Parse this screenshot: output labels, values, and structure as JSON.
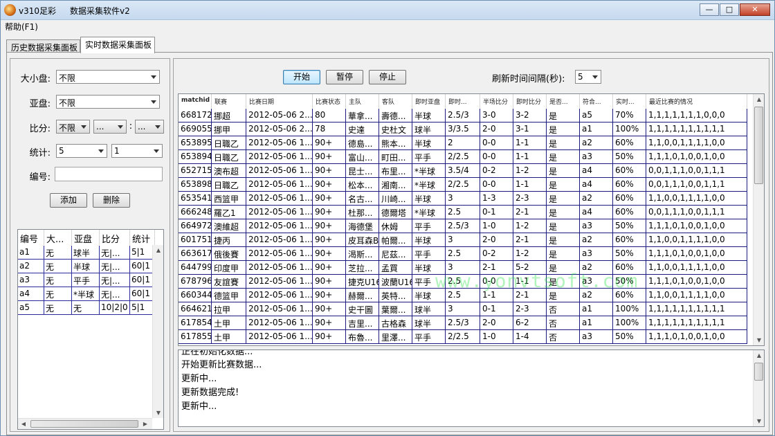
{
  "window": {
    "title": "v310足彩",
    "subtitle": "数据采集软件v2",
    "minimize_glyph": "—",
    "maximize_glyph": "□",
    "close_glyph": "✕"
  },
  "menu": {
    "help": "帮助(F1)"
  },
  "tabs": {
    "history": "历史数据采集面板",
    "realtime": "实时数据采集面板"
  },
  "filters": {
    "size_label": "大小盘:",
    "size_value": "不限",
    "asian_label": "亚盘:",
    "asian_value": "不限",
    "score_label": "比分:",
    "score_value": "不限",
    "score_home": "...",
    "score_sep": ":",
    "score_away": "...",
    "stat_label": "统计:",
    "stat_value1": "5",
    "stat_value2": "1",
    "id_label": "编号:",
    "id_value": "",
    "add_button": "添加",
    "delete_button": "删除"
  },
  "rule_table": {
    "headers": [
      "编号",
      "大...",
      "亚盘",
      "比分",
      "统计"
    ],
    "rows": [
      [
        "a1",
        "无",
        "球半",
        "无|...",
        "5|1"
      ],
      [
        "a2",
        "无",
        "半球",
        "无|...",
        "60|1"
      ],
      [
        "a3",
        "无",
        "平手",
        "无|...",
        "60|1"
      ],
      [
        "a4",
        "无",
        "*半球",
        "无|...",
        "60|1"
      ],
      [
        "a5",
        "无",
        "无",
        "10|2|0",
        "5|1"
      ]
    ]
  },
  "controls": {
    "start": "开始",
    "pause": "暂停",
    "stop": "停止",
    "interval_label": "刷新时间间隔(秒):",
    "interval_value": "5"
  },
  "match_table": {
    "headers": [
      "matchid",
      "联赛",
      "比赛日期",
      "比赛状态",
      "主队",
      "客队",
      "即时亚盘",
      "即时...",
      "半场比分",
      "即时比分",
      "是否...",
      "符合...",
      "实时...",
      "最近比赛的情况"
    ],
    "rows": [
      [
        "668172",
        "挪超",
        "2012-05-06 2...",
        "80",
        "華拿...",
        "壽德...",
        "半球",
        "2.5/3",
        "3-0",
        "3-2",
        "是",
        "a5",
        "70%",
        "1,1,1,1,1,1,1,0,0,0"
      ],
      [
        "669055",
        "挪甲",
        "2012-05-06 2...",
        "78",
        "史達",
        "史杜文",
        "球半",
        "3/3.5",
        "2-0",
        "3-1",
        "是",
        "a1",
        "100%",
        "1,1,1,1,1,1,1,1,1,1"
      ],
      [
        "653895",
        "日職乙",
        "2012-05-06 1...",
        "90+",
        "德島...",
        "熊本...",
        "半球",
        "2",
        "0-0",
        "1-1",
        "是",
        "a2",
        "60%",
        "1,1,0,0,1,1,1,1,0,0"
      ],
      [
        "653894",
        "日職乙",
        "2012-05-06 1...",
        "90+",
        "富山...",
        "町田...",
        "平手",
        "2/2.5",
        "0-0",
        "1-1",
        "是",
        "a3",
        "50%",
        "1,1,1,0,1,0,0,1,0,0"
      ],
      [
        "652715",
        "澳布超",
        "2012-05-06 1...",
        "90+",
        "昆士...",
        "布里...",
        "*半球",
        "3.5/4",
        "0-2",
        "1-2",
        "是",
        "a4",
        "60%",
        "0,0,1,1,1,0,0,1,1,1"
      ],
      [
        "653898",
        "日職乙",
        "2012-05-06 1...",
        "90+",
        "松本...",
        "湘南...",
        "*半球",
        "2/2.5",
        "0-0",
        "1-1",
        "是",
        "a4",
        "60%",
        "0,0,1,1,1,0,0,1,1,1"
      ],
      [
        "653541",
        "西篮甲",
        "2012-05-06 1...",
        "90+",
        "名古...",
        "川崎...",
        "半球",
        "3",
        "1-3",
        "2-3",
        "是",
        "a2",
        "60%",
        "1,1,0,0,1,1,1,1,0,0"
      ],
      [
        "666248",
        "羅乙1",
        "2012-05-06 1...",
        "90+",
        "杜那...",
        "德爾塔",
        "*半球",
        "2.5",
        "0-1",
        "2-1",
        "是",
        "a4",
        "60%",
        "0,0,1,1,1,0,0,1,1,1"
      ],
      [
        "664972",
        "澳維超",
        "2012-05-06 1...",
        "90+",
        "海德堡",
        "休姆",
        "平手",
        "2.5/3",
        "1-0",
        "1-2",
        "是",
        "a3",
        "50%",
        "1,1,1,0,1,0,0,1,0,0"
      ],
      [
        "601751",
        "捷丙",
        "2012-05-06 1...",
        "90+",
        "皮耳森B",
        "帕爾...",
        "半球",
        "3",
        "2-0",
        "2-1",
        "是",
        "a2",
        "60%",
        "1,1,0,0,1,1,1,1,0,0"
      ],
      [
        "663617",
        "俄後賽",
        "2012-05-06 1...",
        "90+",
        "渴斯...",
        "尼茲...",
        "平手",
        "2.5",
        "0-2",
        "1-2",
        "是",
        "a3",
        "50%",
        "1,1,1,0,1,0,0,1,0,0"
      ],
      [
        "644799",
        "印度甲",
        "2012-05-06 1...",
        "90+",
        "芝拉...",
        "孟買",
        "半球",
        "3",
        "2-1",
        "5-2",
        "是",
        "a2",
        "60%",
        "1,1,0,0,1,1,1,1,0,0"
      ],
      [
        "678796",
        "友誼賽",
        "2012-05-06 1...",
        "90+",
        "捷克U16",
        "波蘭U16",
        "平手",
        "2.5",
        "0-0",
        "1-1",
        "是",
        "a3",
        "50%",
        "1,1,1,0,1,0,0,1,0,0"
      ],
      [
        "660344",
        "德篮甲",
        "2012-05-06 1...",
        "90+",
        "赫爾...",
        "英特...",
        "半球",
        "2.5",
        "1-1",
        "2-1",
        "是",
        "a2",
        "60%",
        "1,1,0,0,1,1,1,1,0,0"
      ],
      [
        "664621",
        "拉甲",
        "2012-05-06 1...",
        "90+",
        "史干圖",
        "葉爾...",
        "球半",
        "3",
        "0-1",
        "2-3",
        "否",
        "a1",
        "100%",
        "1,1,1,1,1,1,1,1,1,1"
      ],
      [
        "617854",
        "土甲",
        "2012-05-06 1...",
        "90+",
        "吉里...",
        "古格森",
        "球半",
        "2.5/3",
        "2-0",
        "6-2",
        "否",
        "a1",
        "100%",
        "1,1,1,1,1,1,1,1,1,1"
      ],
      [
        "617855",
        "土甲",
        "2012-05-06 1...",
        "90+",
        "布魯...",
        "里澤...",
        "平手",
        "2/2.5",
        "1-0",
        "1-4",
        "否",
        "a3",
        "50%",
        "1,1,1,0,1,0,0,1,0,0"
      ]
    ]
  },
  "log": {
    "lines": [
      "正在初始化数据...",
      "开始更新比赛数据...",
      "更新中...",
      "更新数据完成!",
      "更新中..."
    ]
  },
  "watermark": "www.yonvtsoft.com"
}
